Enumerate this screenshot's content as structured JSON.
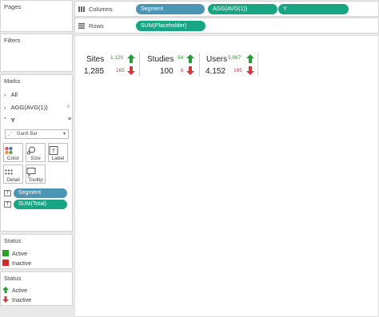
{
  "left_pane": {
    "pages_title": "Pages",
    "filters_title": "Filters",
    "marks": {
      "title": "Marks",
      "rows": [
        {
          "label": "All"
        },
        {
          "label": "AGG(AVG(1))"
        },
        {
          "label": "Y"
        }
      ],
      "mark_type": "Gantt Bar",
      "buttons": [
        {
          "label": "Color",
          "icon": "color-icon"
        },
        {
          "label": "Size",
          "icon": "size-icon"
        },
        {
          "label": "Label",
          "icon": "label-icon"
        },
        {
          "label": "Detail",
          "icon": "detail-icon"
        },
        {
          "label": "Tooltip",
          "icon": "tooltip-icon"
        }
      ],
      "fields": [
        {
          "label": "Segment",
          "color": "#4a96b4"
        },
        {
          "label": "SUM(Total)",
          "color": "#17a583"
        }
      ]
    },
    "status_color_legend": {
      "title": "Status",
      "items": [
        {
          "label": "Active",
          "color": "#2ba02b"
        },
        {
          "label": "Inactive",
          "color": "#d62728"
        }
      ]
    },
    "status_shape_legend": {
      "title": "Status",
      "items": [
        {
          "label": "Active",
          "icon": "arrow-up-icon",
          "color": "#2a9a3a"
        },
        {
          "label": "Inactive",
          "icon": "arrow-down-icon",
          "color": "#d13a3a"
        }
      ]
    }
  },
  "shelves": {
    "columns_label": "Columns",
    "rows_label": "Rows",
    "column_pills": [
      {
        "label": "Segment",
        "color": "#4a96b4"
      },
      {
        "label": "AGG(AVG(1))",
        "color": "#17a583"
      },
      {
        "label": "Y",
        "color": "#17a583"
      }
    ],
    "row_pills": [
      {
        "label": "SUM(Placeholder)",
        "color": "#17a583"
      }
    ]
  },
  "view": {
    "kpis": [
      {
        "label": "Sites",
        "value": "1,285",
        "up": "1,120",
        "down": "165"
      },
      {
        "label": "Studies",
        "value": "100",
        "up": "94",
        "down": "6"
      },
      {
        "label": "Users",
        "value": "4,152",
        "up": "3,987",
        "down": "165"
      }
    ]
  }
}
